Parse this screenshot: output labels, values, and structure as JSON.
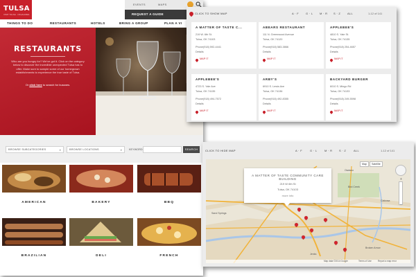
{
  "main_site": {
    "logo": {
      "text": "TULSA",
      "subtext": "VISIT TULSA · OKLAHOMA"
    },
    "top_nav": {
      "events": "EVENTS",
      "maps": "MAPS",
      "request": "REQUEST A GUIDE",
      "extra": "(CIT"
    },
    "main_nav": [
      "THINGS TO DO",
      "RESTAURANTS",
      "HOTELS",
      "BRING A GROUP",
      "PLAN A VI"
    ],
    "hero": {
      "title": "RESTAURANTS",
      "description": "Who are you hungry for? We've got it. Click on the category below to discover the incredible unexpected Tulsa has to offer. Make sure to sample some of our homegrown establishments to experience the true taste of Tulsa.",
      "link_prefix": "Or",
      "link_text": "click here",
      "link_suffix": "to search for bussnes."
    },
    "filters": {
      "subcategories": "BROWSE SUBCATEGORIES",
      "locations": "BROWSE LOCATIONS",
      "keyword_label": "KEYWORD",
      "search_button": "SEARCH"
    },
    "categories": [
      {
        "label": "AMERICAN",
        "color_a": "#7a4a22",
        "color_b": "#c38a48"
      },
      {
        "label": "BAKERY",
        "color_a": "#8b2a1c",
        "color_b": "#d4875c"
      },
      {
        "label": "BBQ",
        "color_a": "#5a2014",
        "color_b": "#a8502a"
      },
      {
        "label": "BRAZILIAN",
        "color_a": "#3a2016",
        "color_b": "#b6784a"
      },
      {
        "label": "DELI",
        "color_a": "#6c5a3c",
        "color_b": "#e0c890"
      },
      {
        "label": "FRENCH",
        "color_a": "#7c4a22",
        "color_b": "#e5b24e"
      }
    ]
  },
  "listing": {
    "show_map": "CLICK TO SHOW MAP",
    "alpha_filters": [
      "A · F",
      "G · L",
      "M · R",
      "S · Z",
      "ALL"
    ],
    "count_text": "1-12 of 141",
    "restaurants": [
      {
        "name": "A MATTER OF TASTE C...",
        "street": "219 W. 6th St.",
        "city": "Tulsa, OK 74103",
        "phone": "Phone(918) 592-4441",
        "details": "Details",
        "map": "MAP IT"
      },
      {
        "name": "ABEARS RESTAURANT",
        "street": "111 N. Greenwood Avenue",
        "city": "Tulsa, OK 74120",
        "phone": "Phone(918) 583-3866",
        "details": "Details",
        "map": "MAP IT"
      },
      {
        "name": "APPLEBEE'S",
        "street": "4810 S. Yale St.",
        "city": "Tulsa, OK 74135",
        "phone": "Phone(918) 254-4657",
        "details": "Details",
        "map": "MAP IT"
      },
      {
        "name": "APPLEBEE'S",
        "street": "4723 S. Yale Ave",
        "city": "Tulsa, OK 74135",
        "phone": "Phone(918) 494-7572",
        "details": "Details",
        "map": "MAP IT"
      },
      {
        "name": "ARBY'S",
        "street": "6910 S. Lewis Ave",
        "city": "Tulsa, OK 74136",
        "phone": "Phone(918) 492-8355",
        "details": "Details",
        "map": "MAP IT"
      },
      {
        "name": "BACKYARD BURGER",
        "street": "6010 S. Mingo Rd",
        "city": "Tulsa, OK 74133",
        "phone": "Phone(918) 249-5598",
        "details": "Details",
        "map": "MAP IT"
      }
    ]
  },
  "map_panel": {
    "hide_map": "CLICK TO HIDE MAP",
    "alpha_filters": [
      "A · F",
      "G · L",
      "M · R",
      "S · Z",
      "ALL"
    ],
    "count_text": "1-12 of 141",
    "info_window": {
      "title": "A MATTER OF TASTE COMMUNITY CARE BUILDING",
      "street": "219 W 6th St",
      "city": "Tulsa, OK 74103",
      "more": "more info"
    },
    "map_types": [
      "Map",
      "Satellite"
    ],
    "place_labels": [
      "Owasso",
      "Catoosa",
      "Bird Creek",
      "Broken Arrow",
      "Sand Springs",
      "Jenks"
    ],
    "footer": [
      "Map data ©2014 Google",
      "Terms of Use",
      "Report a map error"
    ],
    "water_color": "#a9c6e8",
    "road_color": "#f1b33a",
    "urban_color": "#e5d9c0"
  },
  "colors": {
    "brand_red": "#c8202a",
    "dark_bar": "#3a3a3a"
  }
}
